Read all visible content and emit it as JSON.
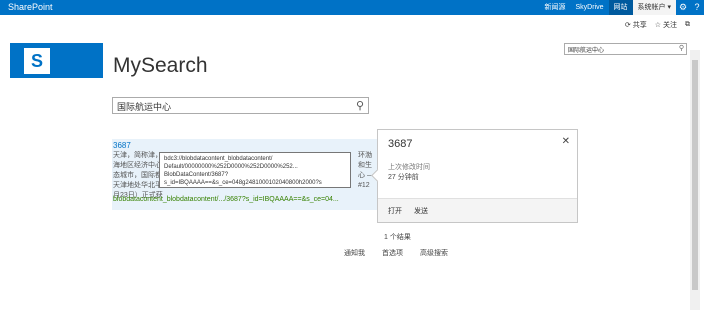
{
  "topbar": {
    "brand": "SharePoint",
    "links": [
      "新闻源",
      "SkyDrive",
      "网站"
    ],
    "user": "系统帐户 ▾",
    "settings_icon": "gear-icon",
    "help_icon": "help-icon"
  },
  "actions": {
    "share": "共享",
    "follow": "关注"
  },
  "site_search": {
    "value": "国际航运中心"
  },
  "site": {
    "title": "MySearch"
  },
  "search": {
    "value": "国际航运中心"
  },
  "result": {
    "title": "3687",
    "snippet_lines": [
      "天津，简称津，",
      "海地区经济中心",
      "态城市，国际都",
      "天津地处华北平",
      "月23日）正式获"
    ],
    "right_lines": [
      "环渤",
      "和生",
      "心 —",
      "#12"
    ],
    "url": "blobdatacontent_blobdatacontent/.../3687?s_id=IBQAAAA==&s_ce=04..."
  },
  "tooltip": {
    "lines": [
      "bdc3://blobdatacontent_blobdatacontent/",
      "Default/00000000%252D0000%252D0000%252...",
      "BlobDataContent/3687?",
      "s_id=IBQAAAA==&s_ce=048g2481000102040800h2000?s"
    ]
  },
  "hover": {
    "title": "3687",
    "modified_label": "上次修改时间",
    "modified_value": "27 分钟前",
    "open": "打开",
    "send": "发送"
  },
  "results": {
    "count": "1 个结果"
  },
  "footer": {
    "alert": "通知我",
    "prefs": "首选项",
    "advanced": "高级搜索"
  }
}
